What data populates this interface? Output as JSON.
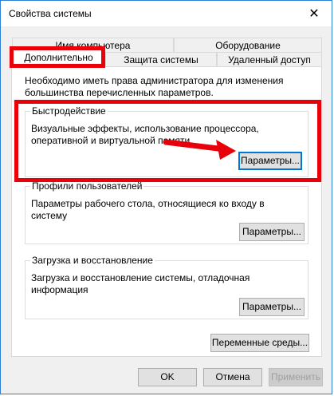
{
  "window": {
    "title": "Свойства системы",
    "close_glyph": "✕"
  },
  "tabs": {
    "back_row": [
      {
        "label": "Имя компьютера"
      },
      {
        "label": "Оборудование"
      }
    ],
    "front_row": [
      {
        "label": "Дополнительно",
        "active": true
      },
      {
        "label": "Защита системы"
      },
      {
        "label": "Удаленный доступ"
      }
    ]
  },
  "panel": {
    "note": "Необходимо иметь права администратора для изменения большинства перечисленных параметров.",
    "groups": [
      {
        "title": "Быстродействие",
        "text": "Визуальные эффекты, использование процессора, оперативной и виртуальной памяти",
        "button": "Параметры..."
      },
      {
        "title": "Профили пользователей",
        "text": "Параметры рабочего стола, относящиеся ко входу в систему",
        "button": "Параметры..."
      },
      {
        "title": "Загрузка и восстановление",
        "text": "Загрузка и восстановление системы, отладочная информация",
        "button": "Параметры..."
      }
    ],
    "env_button": "Переменные среды..."
  },
  "footer": {
    "ok": "OK",
    "cancel": "Отмена",
    "apply": "Применить"
  },
  "colors": {
    "highlight": "#e8000b",
    "accent": "#0078d7",
    "window_border": "#2b7fd4"
  },
  "icons": {
    "close": "close-icon"
  }
}
